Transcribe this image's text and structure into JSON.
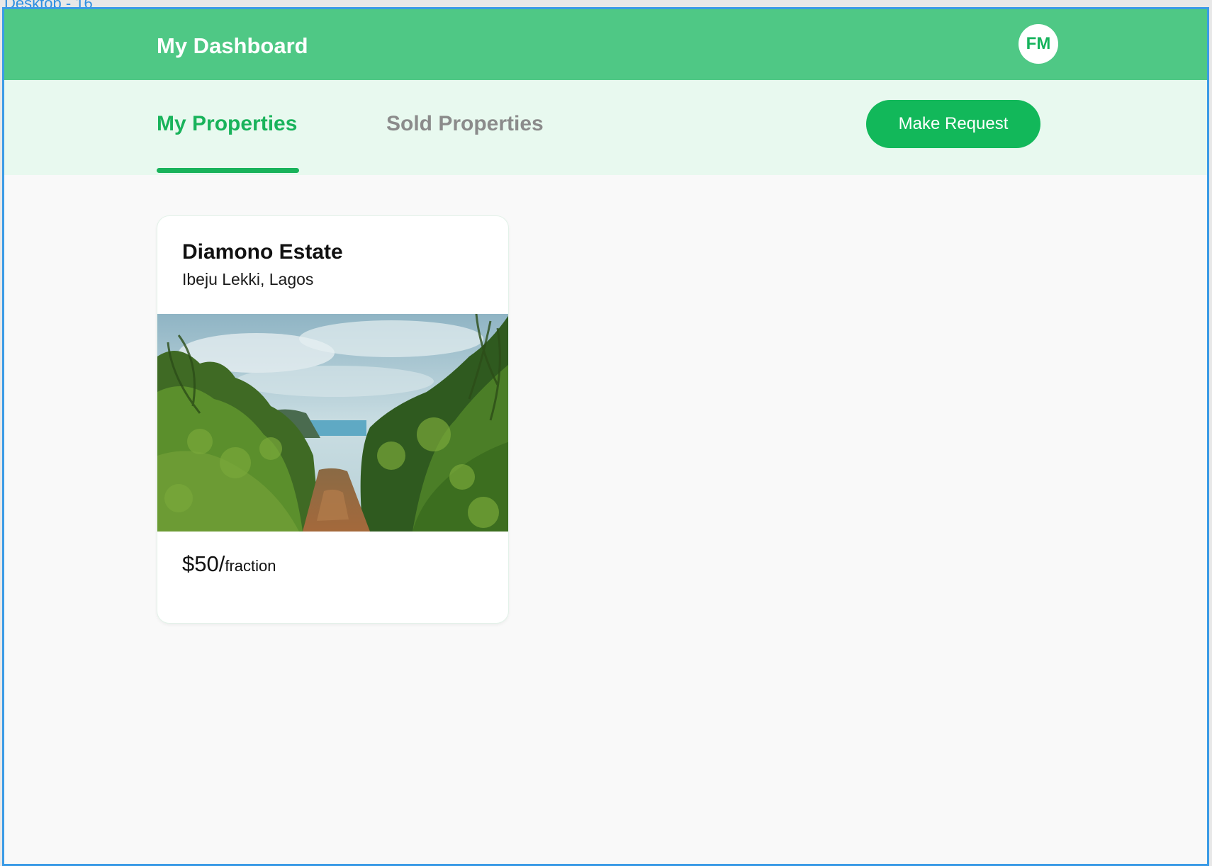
{
  "frame": {
    "label": "Desktop - 16"
  },
  "header": {
    "title": "My Dashboard",
    "avatar_initials": "FM"
  },
  "tabs": [
    {
      "label": "My Properties",
      "active": true
    },
    {
      "label": "Sold Properties",
      "active": false
    }
  ],
  "actions": {
    "make_request_label": "Make Request"
  },
  "properties": [
    {
      "name": "Diamono Estate",
      "location": "Ibeju Lekki, Lagos",
      "image": "tropical-path-landscape",
      "price_amount": "$50/",
      "price_unit": "fraction"
    }
  ],
  "colors": {
    "header_bg": "#4fc885",
    "tabbar_bg": "#e8f9ef",
    "accent": "#19b35b",
    "inactive_tab": "#8b8b8b",
    "frame_border": "#3b9be6"
  }
}
